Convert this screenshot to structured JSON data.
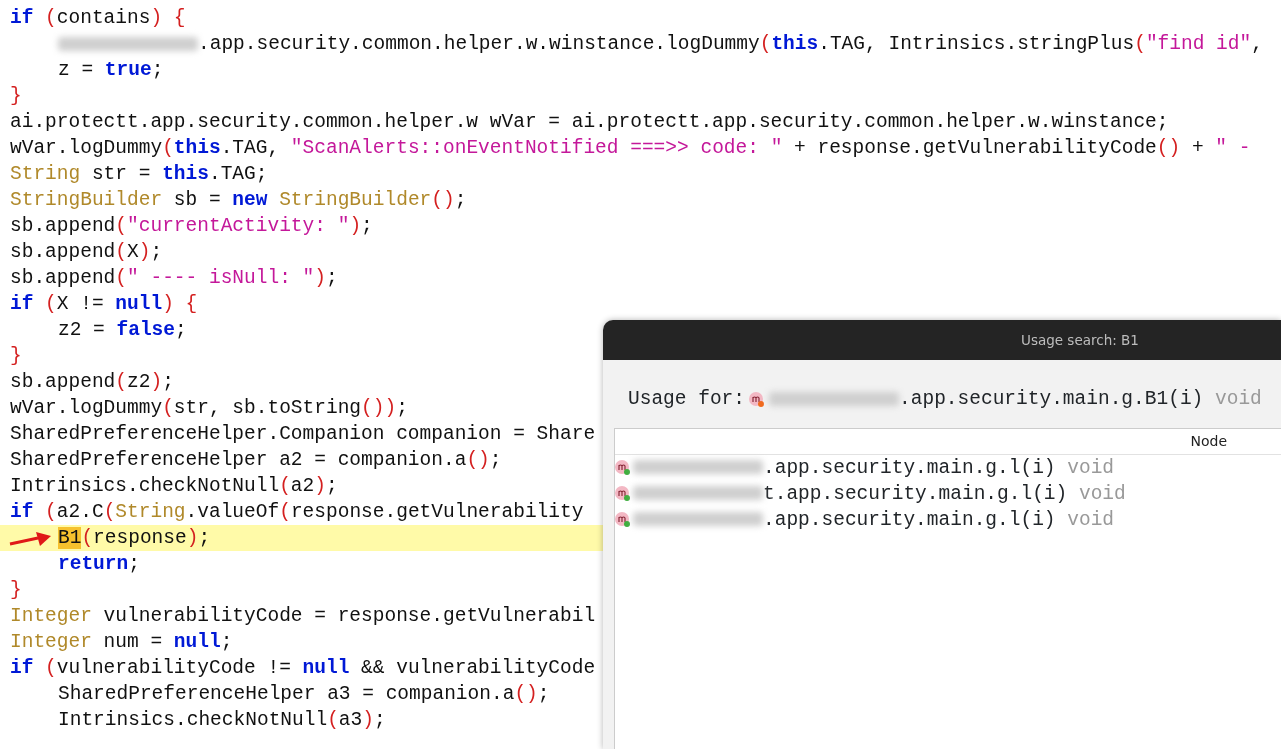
{
  "code_lines": [
    {
      "tokens": [
        {
          "kind": "kw",
          "text": "if"
        },
        {
          "kind": "punct",
          "text": " ("
        },
        {
          "kind": "plain",
          "text": "contains"
        },
        {
          "kind": "punct",
          "text": ")"
        },
        {
          "kind": "punct",
          "text": " {"
        }
      ]
    },
    {
      "indented": true,
      "tokens": [
        {
          "kind": "redacted"
        },
        {
          "kind": "plain",
          "text": ".app.security.common.helper.w.winstance.logDummy"
        },
        {
          "kind": "punct",
          "text": "("
        },
        {
          "kind": "kw",
          "text": "this"
        },
        {
          "kind": "plain",
          "text": ".TAG, Intrinsics.stringPlus"
        },
        {
          "kind": "punct",
          "text": "("
        },
        {
          "kind": "str",
          "text": "\"find id\""
        },
        {
          "kind": "plain",
          "text": ","
        }
      ]
    },
    {
      "indented": true,
      "tokens": [
        {
          "kind": "plain",
          "text": "z = "
        },
        {
          "kind": "kw",
          "text": "true"
        },
        {
          "kind": "plain",
          "text": ";"
        }
      ]
    },
    {
      "tokens": [
        {
          "kind": "punct",
          "text": "}"
        }
      ]
    },
    {
      "tokens": [
        {
          "kind": "plain",
          "text": "ai.protectt.app.security.common.helper.w wVar = ai.protectt.app.security.common.helper.w.winstance;"
        }
      ]
    },
    {
      "tokens": [
        {
          "kind": "plain",
          "text": "wVar.logDummy"
        },
        {
          "kind": "punct",
          "text": "("
        },
        {
          "kind": "kw",
          "text": "this"
        },
        {
          "kind": "plain",
          "text": ".TAG, "
        },
        {
          "kind": "str",
          "text": "\"ScanAlerts::onEventNotified ===>> code: \""
        },
        {
          "kind": "plain",
          "text": " + response.getVulnerabilityCode"
        },
        {
          "kind": "punct",
          "text": "()"
        },
        {
          "kind": "plain",
          "text": " + "
        },
        {
          "kind": "str",
          "text": "\" -"
        }
      ]
    },
    {
      "tokens": [
        {
          "kind": "type",
          "text": "String"
        },
        {
          "kind": "plain",
          "text": " str = "
        },
        {
          "kind": "kw",
          "text": "this"
        },
        {
          "kind": "plain",
          "text": ".TAG;"
        }
      ]
    },
    {
      "tokens": [
        {
          "kind": "type",
          "text": "StringBuilder"
        },
        {
          "kind": "plain",
          "text": " sb = "
        },
        {
          "kind": "kw",
          "text": "new"
        },
        {
          "kind": "type",
          "text": " StringBuilder"
        },
        {
          "kind": "punct",
          "text": "()"
        },
        {
          "kind": "plain",
          "text": ";"
        }
      ]
    },
    {
      "tokens": [
        {
          "kind": "plain",
          "text": "sb.append"
        },
        {
          "kind": "punct",
          "text": "("
        },
        {
          "kind": "str",
          "text": "\"currentActivity: \""
        },
        {
          "kind": "punct",
          "text": ")"
        },
        {
          "kind": "plain",
          "text": ";"
        }
      ]
    },
    {
      "tokens": [
        {
          "kind": "plain",
          "text": "sb.append"
        },
        {
          "kind": "punct",
          "text": "("
        },
        {
          "kind": "plain",
          "text": "X"
        },
        {
          "kind": "punct",
          "text": ")"
        },
        {
          "kind": "plain",
          "text": ";"
        }
      ]
    },
    {
      "tokens": [
        {
          "kind": "plain",
          "text": "sb.append"
        },
        {
          "kind": "punct",
          "text": "("
        },
        {
          "kind": "str",
          "text": "\" ---- isNull: \""
        },
        {
          "kind": "punct",
          "text": ")"
        },
        {
          "kind": "plain",
          "text": ";"
        }
      ]
    },
    {
      "tokens": [
        {
          "kind": "kw",
          "text": "if"
        },
        {
          "kind": "punct",
          "text": " ("
        },
        {
          "kind": "plain",
          "text": "X != "
        },
        {
          "kind": "kw",
          "text": "null"
        },
        {
          "kind": "punct",
          "text": ")"
        },
        {
          "kind": "punct",
          "text": " {"
        }
      ]
    },
    {
      "indented": true,
      "tokens": [
        {
          "kind": "plain",
          "text": "z2 = "
        },
        {
          "kind": "kw",
          "text": "false"
        },
        {
          "kind": "plain",
          "text": ";"
        }
      ]
    },
    {
      "tokens": [
        {
          "kind": "punct",
          "text": "}"
        }
      ]
    },
    {
      "tokens": [
        {
          "kind": "plain",
          "text": "sb.append"
        },
        {
          "kind": "punct",
          "text": "("
        },
        {
          "kind": "plain",
          "text": "z2"
        },
        {
          "kind": "punct",
          "text": ")"
        },
        {
          "kind": "plain",
          "text": ";"
        }
      ]
    },
    {
      "tokens": [
        {
          "kind": "plain",
          "text": "wVar.logDummy"
        },
        {
          "kind": "punct",
          "text": "("
        },
        {
          "kind": "plain",
          "text": "str, sb.toString"
        },
        {
          "kind": "punct",
          "text": "())"
        },
        {
          "kind": "plain",
          "text": ";"
        }
      ]
    },
    {
      "tokens": [
        {
          "kind": "plain",
          "text": "SharedPreferenceHelper.Companion companion = Share"
        }
      ]
    },
    {
      "tokens": [
        {
          "kind": "plain",
          "text": "SharedPreferenceHelper a2 = companion.a"
        },
        {
          "kind": "punct",
          "text": "()"
        },
        {
          "kind": "plain",
          "text": ";"
        }
      ]
    },
    {
      "tokens": [
        {
          "kind": "plain",
          "text": "Intrinsics.checkNotNull"
        },
        {
          "kind": "punct",
          "text": "("
        },
        {
          "kind": "plain",
          "text": "a2"
        },
        {
          "kind": "punct",
          "text": ")"
        },
        {
          "kind": "plain",
          "text": ";"
        }
      ]
    },
    {
      "tokens": [
        {
          "kind": "kw",
          "text": "if"
        },
        {
          "kind": "punct",
          "text": " ("
        },
        {
          "kind": "plain",
          "text": "a2.C"
        },
        {
          "kind": "punct",
          "text": "("
        },
        {
          "kind": "type",
          "text": "String"
        },
        {
          "kind": "plain",
          "text": ".valueOf"
        },
        {
          "kind": "punct",
          "text": "("
        },
        {
          "kind": "plain",
          "text": "response.getVulnerability"
        }
      ]
    },
    {
      "indented": true,
      "highlighted": true,
      "tokens": [
        {
          "kind": "match",
          "text": "B1"
        },
        {
          "kind": "punct",
          "text": "("
        },
        {
          "kind": "plain",
          "text": "response"
        },
        {
          "kind": "punct",
          "text": ")"
        },
        {
          "kind": "plain",
          "text": ";"
        }
      ]
    },
    {
      "indented": true,
      "tokens": [
        {
          "kind": "kw",
          "text": "return"
        },
        {
          "kind": "plain",
          "text": ";"
        }
      ]
    },
    {
      "tokens": [
        {
          "kind": "punct",
          "text": "}"
        }
      ]
    },
    {
      "tokens": [
        {
          "kind": "type",
          "text": "Integer"
        },
        {
          "kind": "plain",
          "text": " vulnerabilityCode = response.getVulnerabil"
        }
      ]
    },
    {
      "tokens": [
        {
          "kind": "type",
          "text": "Integer"
        },
        {
          "kind": "plain",
          "text": " num = "
        },
        {
          "kind": "kw",
          "text": "null"
        },
        {
          "kind": "plain",
          "text": ";"
        }
      ]
    },
    {
      "tokens": [
        {
          "kind": "kw",
          "text": "if"
        },
        {
          "kind": "punct",
          "text": " ("
        },
        {
          "kind": "plain",
          "text": "vulnerabilityCode != "
        },
        {
          "kind": "kw",
          "text": "null"
        },
        {
          "kind": "plain",
          "text": " && vulnerabilityCode"
        }
      ]
    },
    {
      "indented": true,
      "tokens": [
        {
          "kind": "plain",
          "text": "SharedPreferenceHelper a3 = companion.a"
        },
        {
          "kind": "punct",
          "text": "()"
        },
        {
          "kind": "plain",
          "text": ";"
        }
      ]
    },
    {
      "indented": true,
      "tokens": [
        {
          "kind": "plain",
          "text": "Intrinsics.checkNotNull"
        },
        {
          "kind": "punct",
          "text": "("
        },
        {
          "kind": "plain",
          "text": "a3"
        },
        {
          "kind": "punct",
          "text": ")"
        },
        {
          "kind": "plain",
          "text": ";"
        }
      ]
    }
  ],
  "dialog": {
    "title": "Usage search: B1",
    "usage_label": "Usage for:",
    "usage_target": {
      "text": ".app.security.main.g.B1(i)",
      "return_type": "void"
    },
    "column_header": "Node",
    "results": [
      {
        "text": ".app.security.main.g.l(i)",
        "return_type": "void"
      },
      {
        "text": "t.app.security.main.g.l(i)",
        "return_type": "void"
      },
      {
        "text": ".app.security.main.g.l(i)",
        "return_type": "void"
      }
    ]
  }
}
